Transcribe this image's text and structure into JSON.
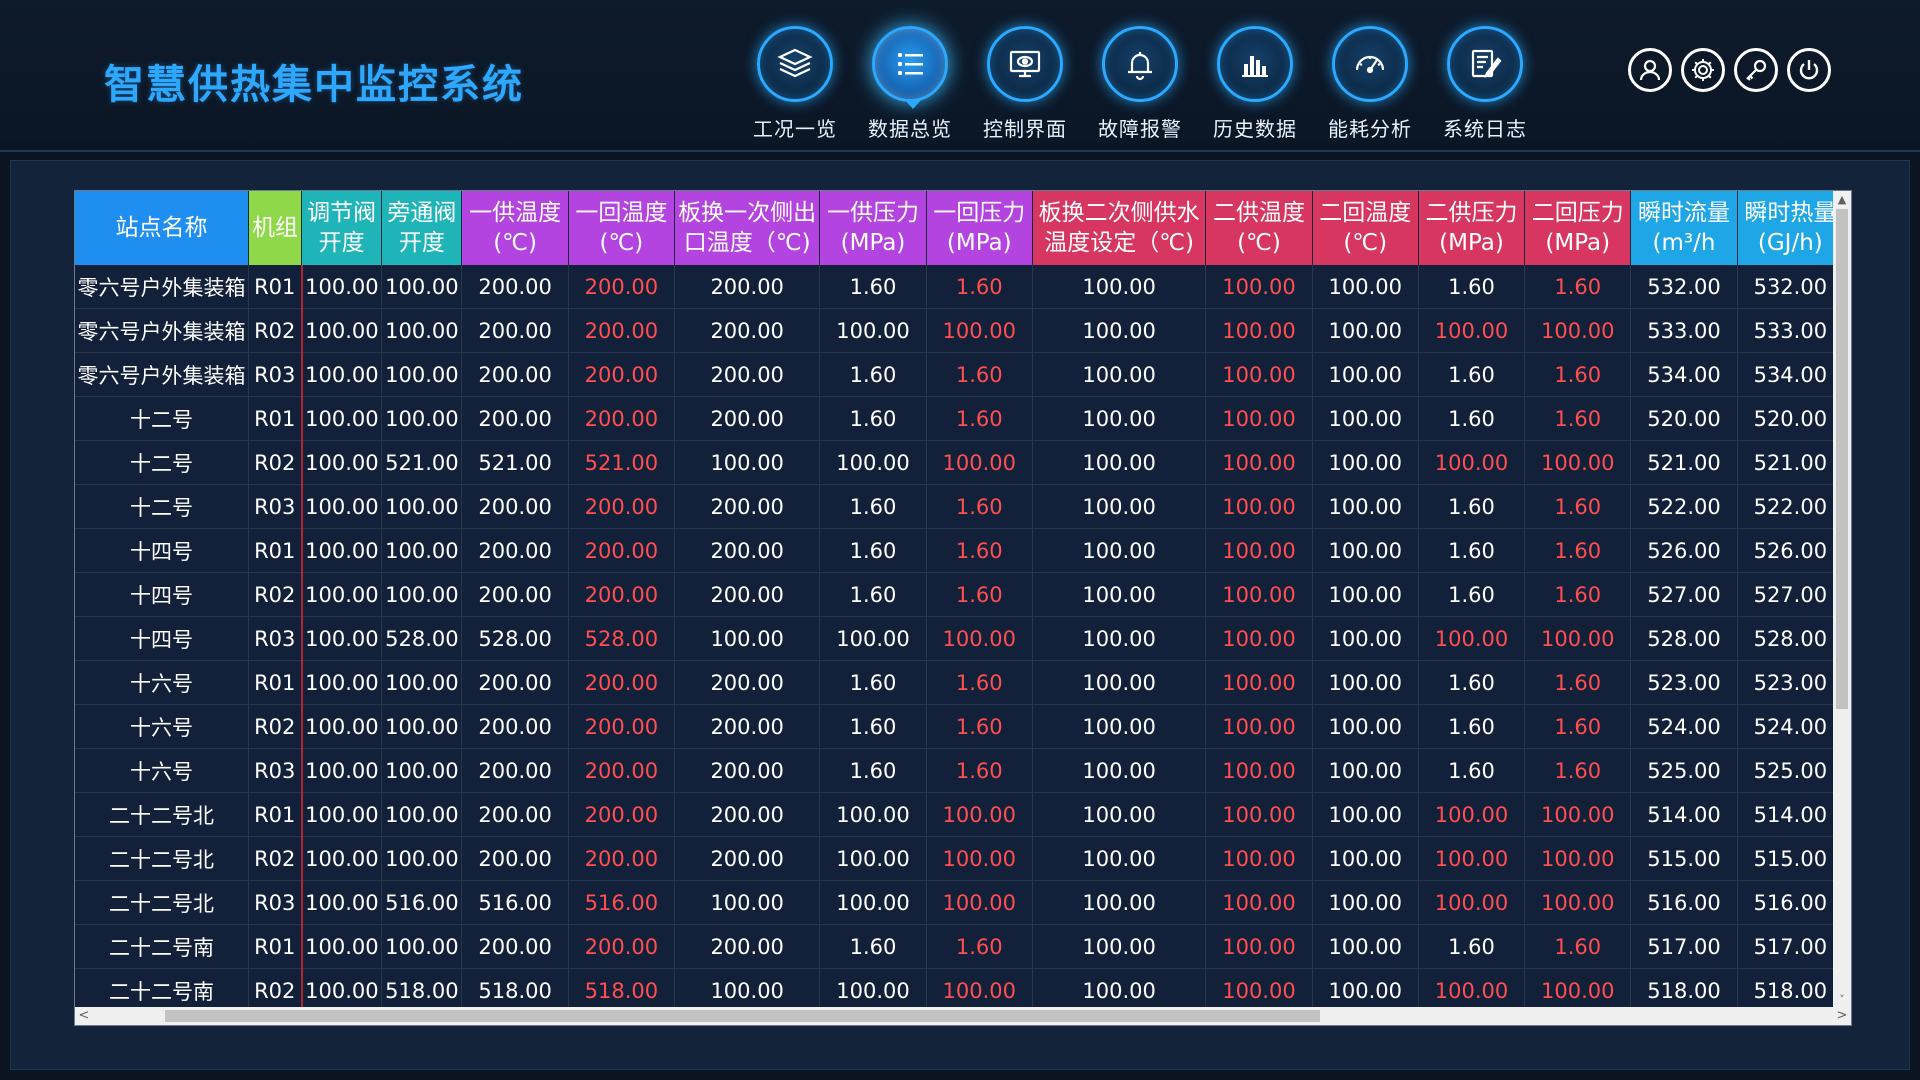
{
  "app": {
    "title": "智慧供热集中监控系统"
  },
  "nav": [
    {
      "label": "工况一览",
      "icon": "layers-icon",
      "active": false
    },
    {
      "label": "数据总览",
      "icon": "list-icon",
      "active": true
    },
    {
      "label": "控制界面",
      "icon": "monitor-icon",
      "active": false
    },
    {
      "label": "故障报警",
      "icon": "bell-icon",
      "active": false
    },
    {
      "label": "历史数据",
      "icon": "bar-chart-icon",
      "active": false
    },
    {
      "label": "能耗分析",
      "icon": "gauge-icon",
      "active": false
    },
    {
      "label": "系统日志",
      "icon": "log-edit-icon",
      "active": false
    }
  ],
  "tools": [
    "user-icon",
    "gear-icon",
    "key-icon",
    "power-icon"
  ],
  "colors": {
    "title": "#2ea8ff",
    "alarm_value": "#ff4f4f",
    "header_blue": "#1e8ff0",
    "header_green": "#8fd84a",
    "header_teal": "#1fb5b8",
    "header_purple": "#b444e0",
    "header_red": "#d6365f",
    "header_cyan": "#1ea6e6"
  },
  "table": {
    "columns": [
      {
        "label": "站点名称",
        "color": "blue"
      },
      {
        "label": "机组",
        "color": "green"
      },
      {
        "label": "调节阀\n开度",
        "color": "teal"
      },
      {
        "label": "旁通阀\n开度",
        "color": "teal"
      },
      {
        "label": "一供温度\n(℃)",
        "color": "purple"
      },
      {
        "label": "一回温度\n(℃)",
        "color": "purple"
      },
      {
        "label": "板换一次侧出\n口温度（℃)",
        "color": "purple"
      },
      {
        "label": "一供压力\n(MPa)",
        "color": "purple"
      },
      {
        "label": "一回压力\n(MPa)",
        "color": "purple"
      },
      {
        "label": "板换二次侧供水\n温度设定（℃)",
        "color": "red"
      },
      {
        "label": "二供温度\n(℃)",
        "color": "red"
      },
      {
        "label": "二回温度\n(℃)",
        "color": "red"
      },
      {
        "label": "二供压力\n(MPa)",
        "color": "red"
      },
      {
        "label": "二回压力\n(MPa)",
        "color": "red"
      },
      {
        "label": "瞬时流量\n(m³/h",
        "color": "cyan"
      },
      {
        "label": "瞬时热量\n(GJ/h)",
        "color": "cyan"
      }
    ],
    "rows": [
      [
        "零六号户外集装箱",
        "R01",
        "100.00",
        "100.00",
        "200.00",
        "200.00",
        "200.00",
        "1.60",
        "1.60",
        "100.00",
        "100.00",
        "100.00",
        "1.60",
        "1.60",
        "532.00",
        "532.00"
      ],
      [
        "零六号户外集装箱",
        "R02",
        "100.00",
        "100.00",
        "200.00",
        "200.00",
        "200.00",
        "100.00",
        "100.00",
        "100.00",
        "100.00",
        "100.00",
        "100.00",
        "100.00",
        "533.00",
        "533.00"
      ],
      [
        "零六号户外集装箱",
        "R03",
        "100.00",
        "100.00",
        "200.00",
        "200.00",
        "200.00",
        "1.60",
        "1.60",
        "100.00",
        "100.00",
        "100.00",
        "1.60",
        "1.60",
        "534.00",
        "534.00"
      ],
      [
        "十二号",
        "R01",
        "100.00",
        "100.00",
        "200.00",
        "200.00",
        "200.00",
        "1.60",
        "1.60",
        "100.00",
        "100.00",
        "100.00",
        "1.60",
        "1.60",
        "520.00",
        "520.00"
      ],
      [
        "十二号",
        "R02",
        "100.00",
        "521.00",
        "521.00",
        "521.00",
        "100.00",
        "100.00",
        "100.00",
        "100.00",
        "100.00",
        "100.00",
        "100.00",
        "100.00",
        "521.00",
        "521.00"
      ],
      [
        "十二号",
        "R03",
        "100.00",
        "100.00",
        "200.00",
        "200.00",
        "200.00",
        "1.60",
        "1.60",
        "100.00",
        "100.00",
        "100.00",
        "1.60",
        "1.60",
        "522.00",
        "522.00"
      ],
      [
        "十四号",
        "R01",
        "100.00",
        "100.00",
        "200.00",
        "200.00",
        "200.00",
        "1.60",
        "1.60",
        "100.00",
        "100.00",
        "100.00",
        "1.60",
        "1.60",
        "526.00",
        "526.00"
      ],
      [
        "十四号",
        "R02",
        "100.00",
        "100.00",
        "200.00",
        "200.00",
        "200.00",
        "1.60",
        "1.60",
        "100.00",
        "100.00",
        "100.00",
        "1.60",
        "1.60",
        "527.00",
        "527.00"
      ],
      [
        "十四号",
        "R03",
        "100.00",
        "528.00",
        "528.00",
        "528.00",
        "100.00",
        "100.00",
        "100.00",
        "100.00",
        "100.00",
        "100.00",
        "100.00",
        "100.00",
        "528.00",
        "528.00"
      ],
      [
        "十六号",
        "R01",
        "100.00",
        "100.00",
        "200.00",
        "200.00",
        "200.00",
        "1.60",
        "1.60",
        "100.00",
        "100.00",
        "100.00",
        "1.60",
        "1.60",
        "523.00",
        "523.00"
      ],
      [
        "十六号",
        "R02",
        "100.00",
        "100.00",
        "200.00",
        "200.00",
        "200.00",
        "1.60",
        "1.60",
        "100.00",
        "100.00",
        "100.00",
        "1.60",
        "1.60",
        "524.00",
        "524.00"
      ],
      [
        "十六号",
        "R03",
        "100.00",
        "100.00",
        "200.00",
        "200.00",
        "200.00",
        "1.60",
        "1.60",
        "100.00",
        "100.00",
        "100.00",
        "1.60",
        "1.60",
        "525.00",
        "525.00"
      ],
      [
        "二十二号北",
        "R01",
        "100.00",
        "100.00",
        "200.00",
        "200.00",
        "200.00",
        "100.00",
        "100.00",
        "100.00",
        "100.00",
        "100.00",
        "100.00",
        "100.00",
        "514.00",
        "514.00"
      ],
      [
        "二十二号北",
        "R02",
        "100.00",
        "100.00",
        "200.00",
        "200.00",
        "200.00",
        "100.00",
        "100.00",
        "100.00",
        "100.00",
        "100.00",
        "100.00",
        "100.00",
        "515.00",
        "515.00"
      ],
      [
        "二十二号北",
        "R03",
        "100.00",
        "516.00",
        "516.00",
        "516.00",
        "100.00",
        "100.00",
        "100.00",
        "100.00",
        "100.00",
        "100.00",
        "100.00",
        "100.00",
        "516.00",
        "516.00"
      ],
      [
        "二十二号南",
        "R01",
        "100.00",
        "100.00",
        "200.00",
        "200.00",
        "200.00",
        "1.60",
        "1.60",
        "100.00",
        "100.00",
        "100.00",
        "1.60",
        "1.60",
        "517.00",
        "517.00"
      ],
      [
        "二十二号南",
        "R02",
        "100.00",
        "518.00",
        "518.00",
        "518.00",
        "100.00",
        "100.00",
        "100.00",
        "100.00",
        "100.00",
        "100.00",
        "100.00",
        "100.00",
        "518.00",
        "518.00"
      ]
    ],
    "red_columns": [
      5,
      8,
      10,
      12,
      13
    ],
    "red_on_high_pressure_columns": [
      12
    ]
  },
  "scrollbars": {
    "up_arrow": "▲",
    "down_arrow": "˅",
    "left_arrow": "<",
    "right_arrow": ">"
  }
}
